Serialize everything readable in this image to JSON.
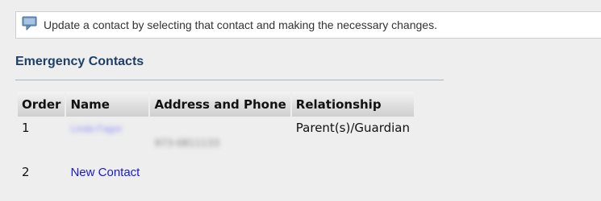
{
  "info": {
    "icon": "comment-icon",
    "message": "Update a contact by selecting that contact and making the necessary changes."
  },
  "section": {
    "title": "Emergency Contacts"
  },
  "table": {
    "headers": [
      "Order",
      "Name",
      "Address and Phone",
      "Relationship"
    ],
    "rows": [
      {
        "order": "1",
        "name": "Linda Fagor",
        "address_phone": "973-0811133",
        "relationship": "Parent(s)/Guardian"
      },
      {
        "order": "2",
        "name": "New Contact",
        "address_phone": "",
        "relationship": ""
      }
    ]
  },
  "colors": {
    "title": "#1f3f66",
    "link": "#1a1ad6",
    "background": "#eeeeee"
  }
}
